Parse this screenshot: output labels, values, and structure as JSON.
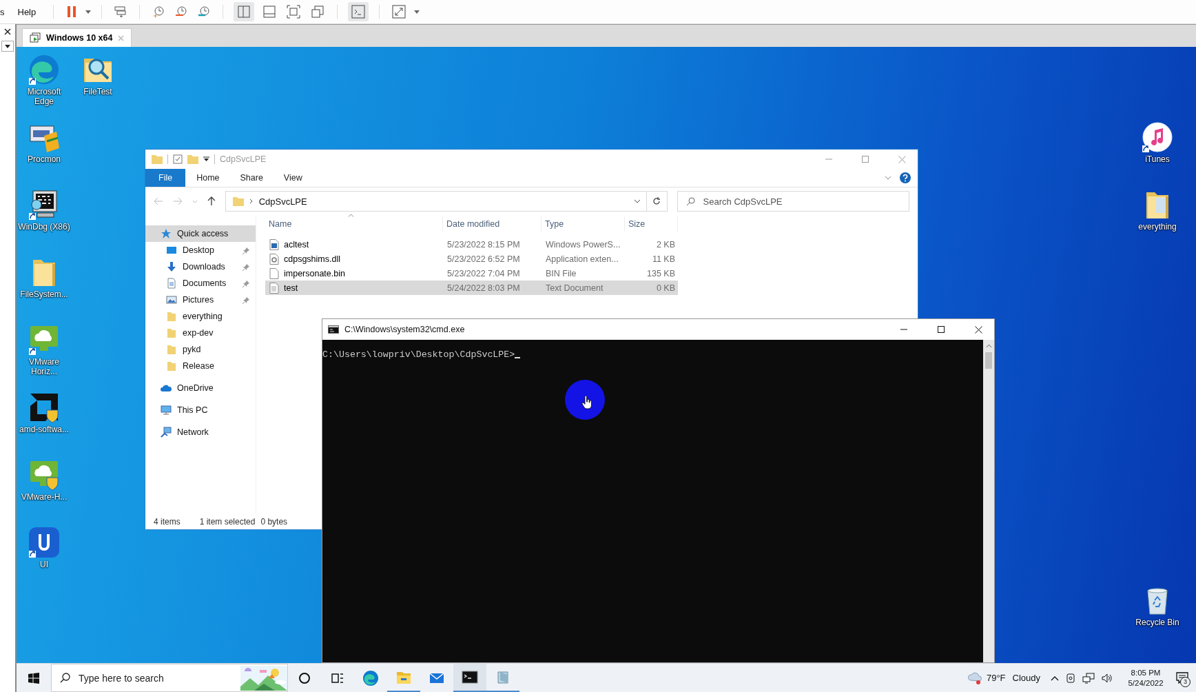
{
  "vm_menu": [
    {
      "label": "s"
    },
    {
      "label": "Help"
    }
  ],
  "vm_tab": {
    "label": "Windows 10 x64"
  },
  "desktop_icons_left": [
    {
      "label": "Microsoft Edge",
      "kind": "edge",
      "shortcut": true
    },
    {
      "label": "Procmon",
      "kind": "procmon",
      "shortcut": false
    },
    {
      "label": "WinDbg (X86)",
      "kind": "windbg",
      "shortcut": true
    },
    {
      "label": "FileSystem...",
      "kind": "folder",
      "shortcut": false
    },
    {
      "label": "VMware Horiz...",
      "kind": "vmware",
      "shortcut": true
    },
    {
      "label": "amd-softwa...",
      "kind": "amd",
      "shortcut": false
    },
    {
      "label": "VMware-H...",
      "kind": "vmware-installer",
      "shortcut": false
    },
    {
      "label": "UI",
      "kind": "ui",
      "shortcut": true
    }
  ],
  "desktop_icons_second": [
    {
      "label": "FileTest",
      "kind": "search-folder",
      "shortcut": false
    }
  ],
  "desktop_icons_right": [
    {
      "label": "iTunes",
      "kind": "itunes",
      "shortcut": true
    },
    {
      "label": "everything",
      "kind": "doc-folder",
      "shortcut": false
    },
    {
      "label": "Recycle Bin",
      "kind": "recycle",
      "shortcut": false
    }
  ],
  "explorer": {
    "title": "CdpSvcLPE",
    "ribbon_tabs": [
      {
        "label": "File",
        "kind": "menu"
      },
      {
        "label": "Home",
        "kind": "tab"
      },
      {
        "label": "Share",
        "kind": "tab"
      },
      {
        "label": "View",
        "kind": "tab"
      }
    ],
    "address": {
      "path": "CdpSvcLPE"
    },
    "search": {
      "placeholder": "Search CdpSvcLPE"
    },
    "nav": [
      {
        "label": "Quick access",
        "kind": "star",
        "selected": true,
        "children": [
          {
            "label": "Desktop",
            "kind": "desktop",
            "pinned": true,
            "selected": false
          },
          {
            "label": "Downloads",
            "kind": "downloads",
            "pinned": true,
            "selected": false
          },
          {
            "label": "Documents",
            "kind": "documents",
            "pinned": true,
            "selected": false
          },
          {
            "label": "Pictures",
            "kind": "pictures",
            "pinned": true,
            "selected": false
          },
          {
            "label": "everything",
            "kind": "folder",
            "pinned": false,
            "selected": false
          },
          {
            "label": "exp-dev",
            "kind": "folder",
            "pinned": false,
            "selected": false
          },
          {
            "label": "pykd",
            "kind": "folder",
            "pinned": false,
            "selected": false
          },
          {
            "label": "Release",
            "kind": "folder",
            "pinned": false,
            "selected": false
          }
        ]
      },
      {
        "label": "OneDrive",
        "kind": "cloud",
        "selected": false
      },
      {
        "label": "This PC",
        "kind": "pc",
        "selected": false
      },
      {
        "label": "Network",
        "kind": "network",
        "selected": false
      }
    ],
    "columns": [
      "Name",
      "Date modified",
      "Type",
      "Size"
    ],
    "files": [
      {
        "name": "acltest",
        "date": "5/23/2022 8:15 PM",
        "type": "Windows PowerS...",
        "size": "2 KB",
        "kind": "script",
        "selected": false
      },
      {
        "name": "cdpsgshims.dll",
        "date": "5/23/2022 6:52 PM",
        "type": "Application exten...",
        "size": "11 KB",
        "kind": "dll",
        "selected": false
      },
      {
        "name": "impersonate.bin",
        "date": "5/23/2022 7:04 PM",
        "type": "BIN File",
        "size": "135 KB",
        "kind": "bin",
        "selected": false
      },
      {
        "name": "test",
        "date": "5/24/2022 8:03 PM",
        "type": "Text Document",
        "size": "0 KB",
        "kind": "text",
        "selected": true
      }
    ],
    "status": [
      "4 items",
      "1 item selected",
      "0 bytes"
    ]
  },
  "cmd": {
    "title": "C:\\Windows\\system32\\cmd.exe",
    "lines": [
      "C:\\Users\\lowpriv\\Desktop\\CdpSvcLPE>"
    ]
  },
  "taskbar": {
    "search_placeholder": "Type here to search",
    "apps": [
      {
        "kind": "cortana",
        "running": false,
        "selected": false
      },
      {
        "kind": "taskview",
        "running": false,
        "selected": false
      },
      {
        "kind": "edge",
        "running": false,
        "selected": false
      },
      {
        "kind": "explorer",
        "running": true,
        "selected": false
      },
      {
        "kind": "mail",
        "running": false,
        "selected": false
      },
      {
        "kind": "cmd",
        "running": true,
        "selected": true
      },
      {
        "kind": "window",
        "running": true,
        "selected": false
      }
    ],
    "weather": {
      "temp": "79°F",
      "condition": "Cloudy"
    },
    "clock": {
      "time": "8:05 PM",
      "date": "5/24/2022"
    },
    "notifications": "3"
  }
}
